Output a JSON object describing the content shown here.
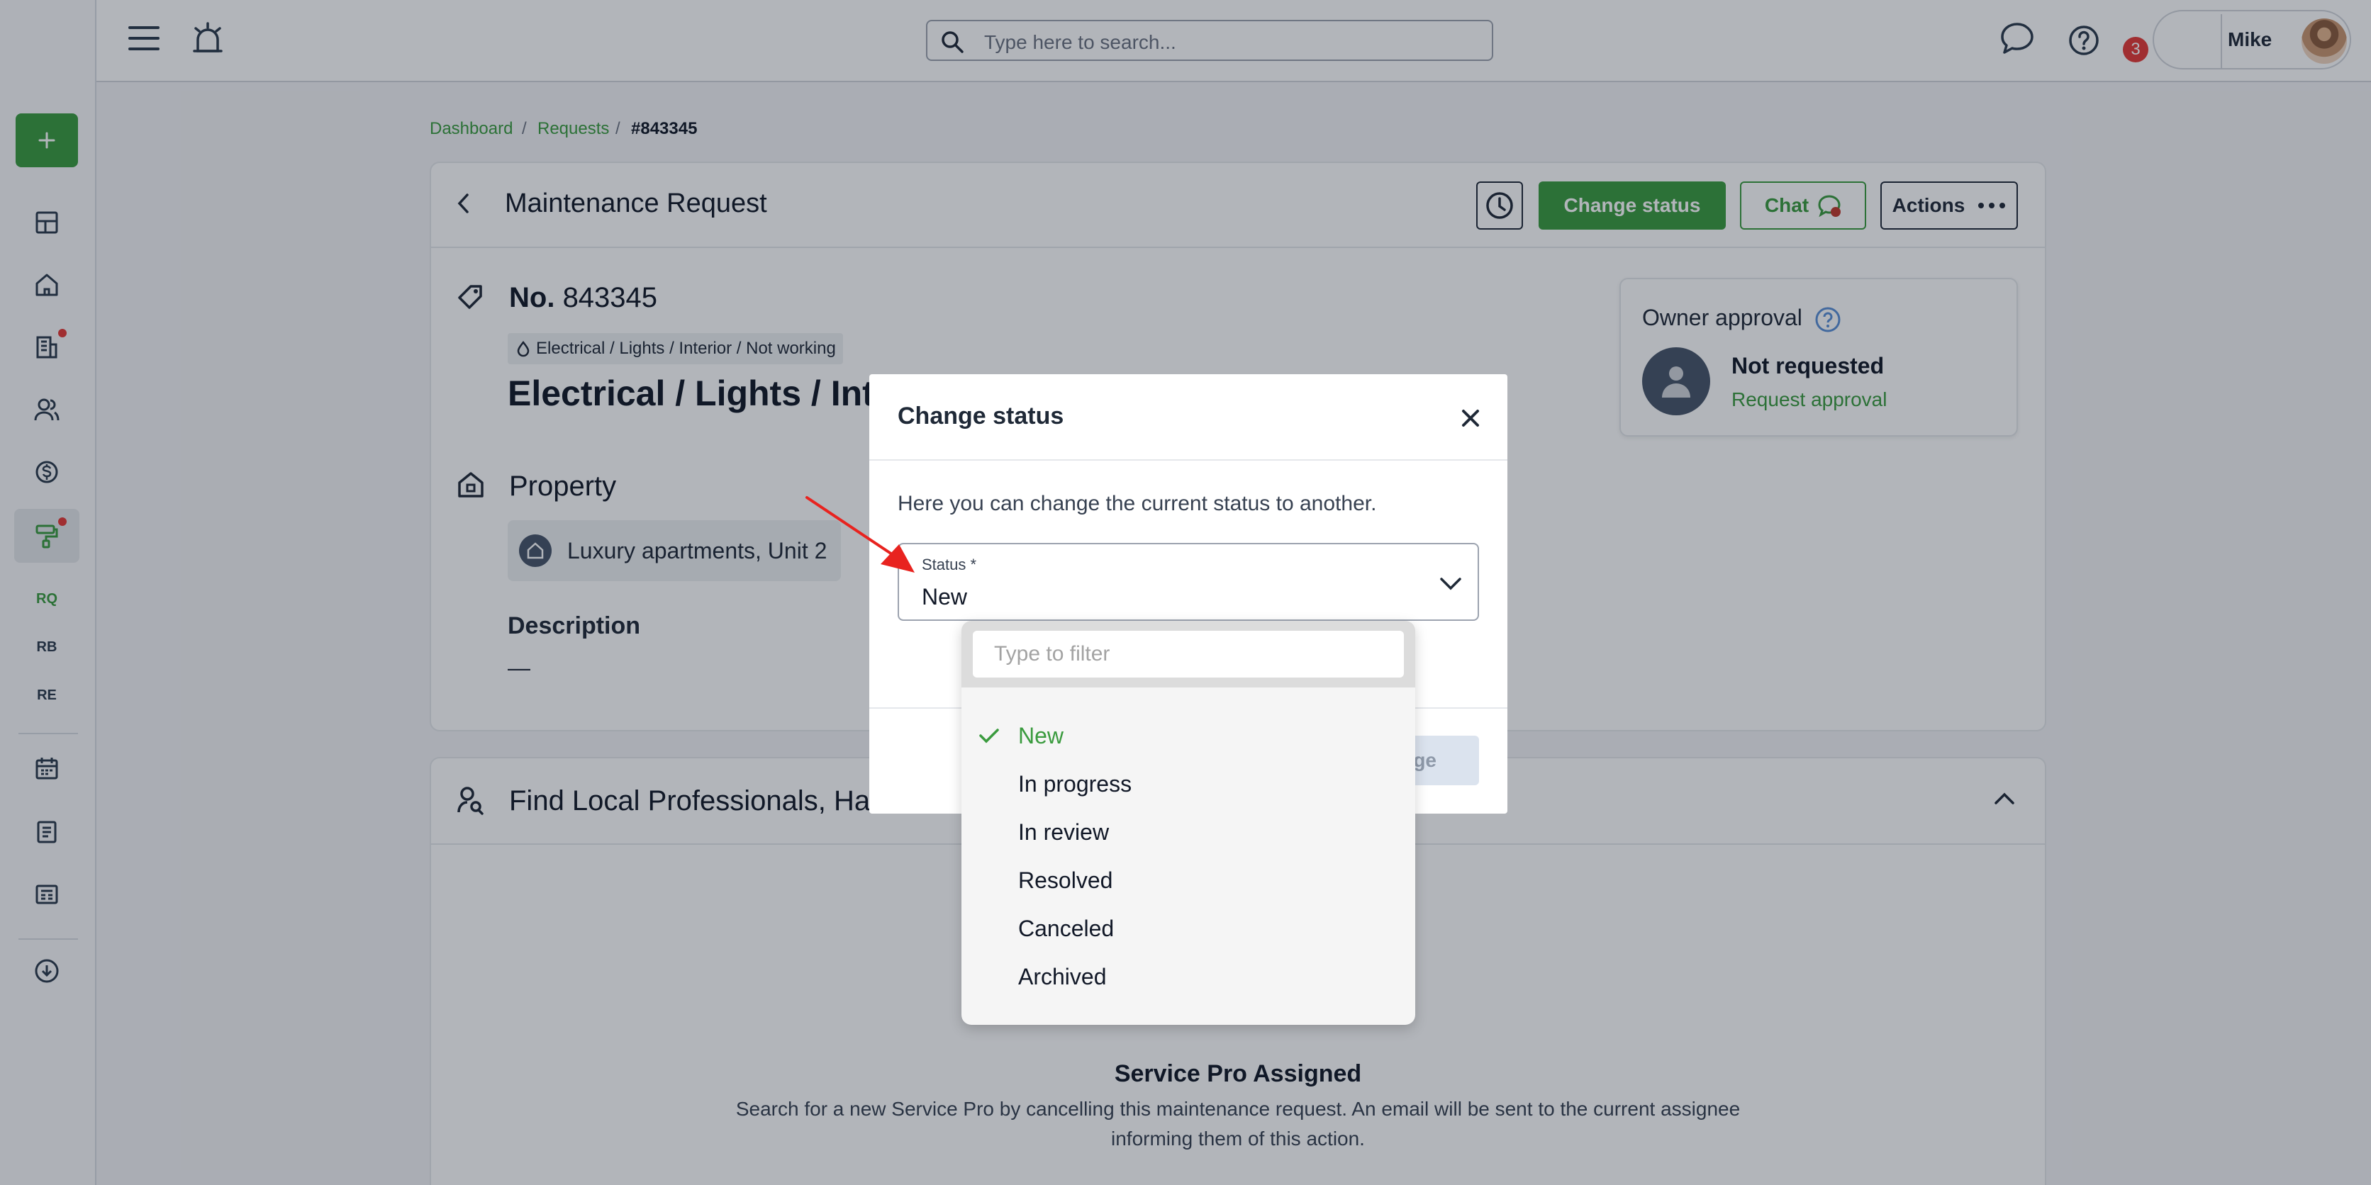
{
  "topbar": {
    "search_placeholder": "Type here to search...",
    "notifications_count": "3",
    "user_name": "Mike"
  },
  "sidebar": {
    "shortcuts": [
      "RQ",
      "RB",
      "RE"
    ]
  },
  "breadcrumb": {
    "items": [
      "Dashboard",
      "Requests",
      "#843345"
    ],
    "separator": "/"
  },
  "header": {
    "title": "Maintenance Request",
    "change_status_label": "Change status",
    "chat_label": "Chat",
    "actions_label": "Actions"
  },
  "request": {
    "number_prefix": "No.",
    "number": "843345",
    "category": "Electrical / Lights / Interior / Not working",
    "title": "Electrical / Lights / Inte",
    "property_heading": "Property",
    "property_name": "Luxury apartments, Unit 2",
    "description_heading": "Description",
    "description_value": "—"
  },
  "owner_approval": {
    "title": "Owner approval",
    "status": "Not requested",
    "link": "Request approval"
  },
  "professionals": {
    "title": "Find Local Professionals, Han",
    "assigned_title": "Service Pro Assigned",
    "assigned_text": "Search for a new Service Pro by cancelling this maintenance request. An email will be sent to the current assignee informing them of this action."
  },
  "modal": {
    "title": "Change status",
    "description": "Here you can change the current status to another.",
    "field_label": "Status *",
    "field_value": "New",
    "submit_partial": "ge"
  },
  "dropdown": {
    "filter_placeholder": "Type to filter",
    "options": [
      "New",
      "In progress",
      "In review",
      "Resolved",
      "Canceled",
      "Archived"
    ],
    "selected": "New"
  },
  "colors": {
    "brand_green": "#3a9b3e",
    "alert_red": "#e53935"
  }
}
